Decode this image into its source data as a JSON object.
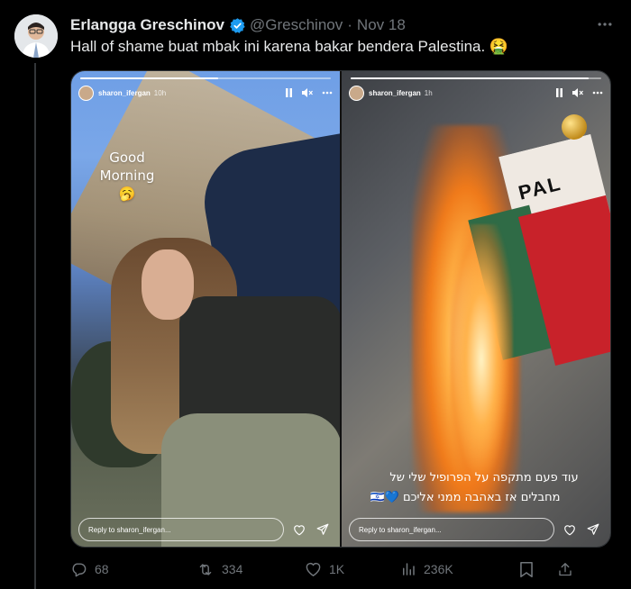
{
  "tweet": {
    "author": {
      "display_name": "Erlangga Greschinov",
      "handle": "@Greschinov"
    },
    "date_separator": "·",
    "date": "Nov 18",
    "text": "Hall of shame buat mbak ini karena bakar bendera Palestina. 🤮"
  },
  "media": {
    "left_story": {
      "username": "sharon_ifergan",
      "time": "10h",
      "progress": 0.55,
      "overlay_text_line1": "Good",
      "overlay_text_line2": "Morning 🥱",
      "reply_placeholder": "Reply to sharon_ifergan..."
    },
    "right_story": {
      "username": "sharon_ifergan",
      "time": "1h",
      "progress": 0.95,
      "flag_letters": "PAL",
      "caption_line1": "עוד פעם מתקפה על הפרופיל שלי של",
      "caption_line2": "מחבלים אז באהבה ממני אליכם 💙🇮🇱",
      "reply_placeholder": "Reply to sharon_ifergan..."
    }
  },
  "actions": {
    "replies": "68",
    "reposts": "334",
    "likes": "1K",
    "views": "236K"
  },
  "colors": {
    "background": "#000000",
    "text": "#e7e9ea",
    "muted": "#71767b",
    "verified": "#1d9bf0",
    "border": "#2f3336"
  },
  "icons": {
    "verified": "verified-badge-icon",
    "more": "more-horizontal-icon",
    "pause": "pause-icon",
    "mute": "muted-speaker-icon",
    "story_more": "more-horizontal-icon",
    "heart": "heart-icon",
    "send": "send-icon",
    "reply": "reply-icon",
    "repost": "repost-icon",
    "like": "like-icon",
    "views": "views-chart-icon",
    "bookmark": "bookmark-icon",
    "share": "share-icon"
  }
}
